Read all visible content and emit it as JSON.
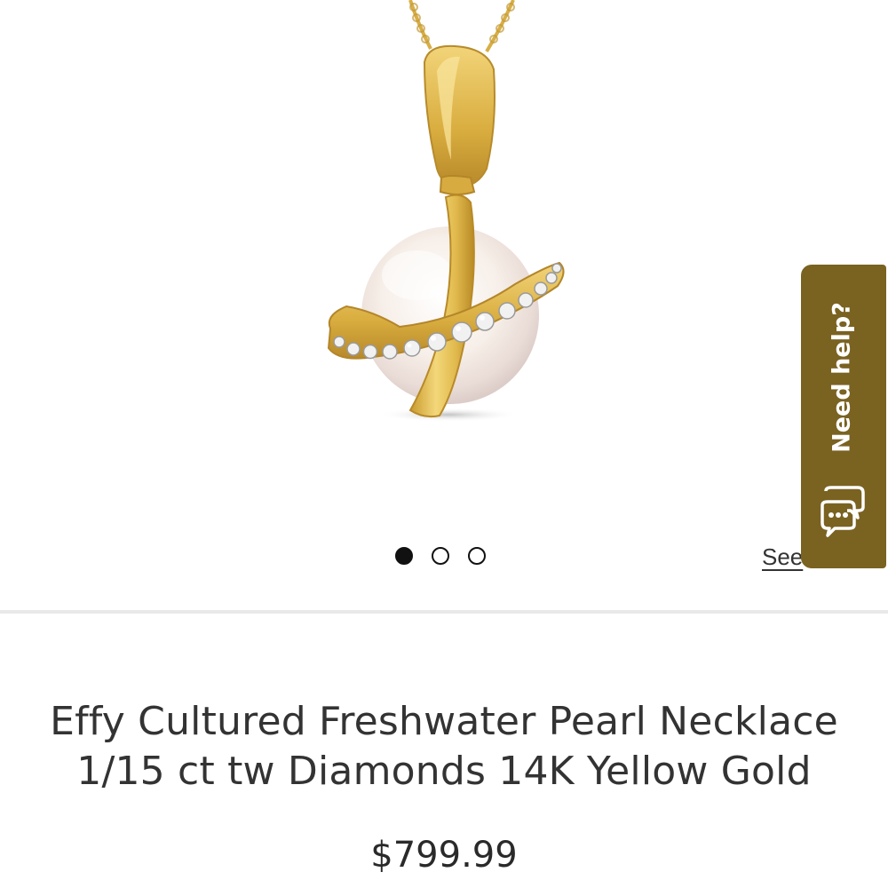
{
  "product": {
    "title_line1": "Effy Cultured Freshwater Pearl Necklace",
    "title_line2": "1/15 ct tw Diamonds 14K Yellow Gold",
    "price": "$799.99"
  },
  "carousel": {
    "dot_count": 3,
    "active_index": 0
  },
  "see_link": {
    "label": "See"
  },
  "help_widget": {
    "label": "Need help?",
    "icon": "chat-bubble-icon",
    "color": "#7a6221"
  },
  "colors": {
    "gold": "#d9b44a",
    "pearl": "#f7f1ea",
    "text": "#333333"
  }
}
